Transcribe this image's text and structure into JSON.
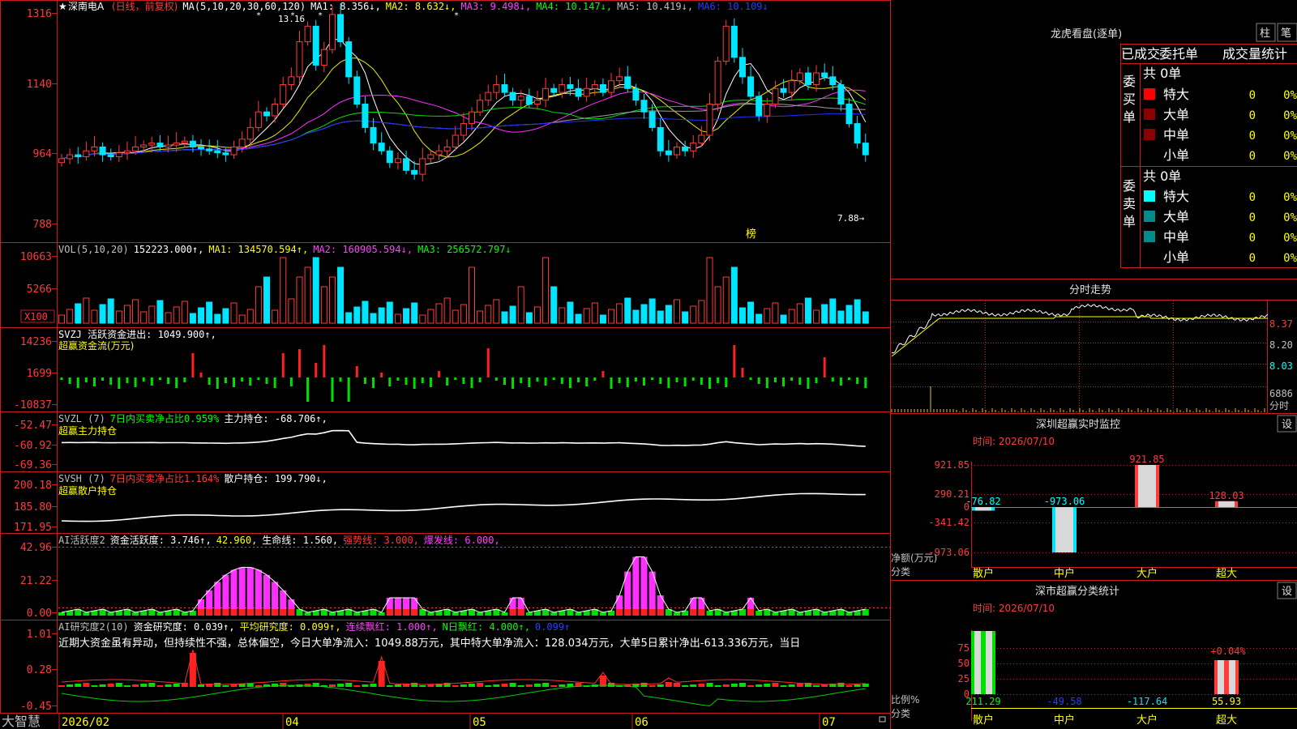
{
  "colors": {
    "up": "#ff3b3b",
    "down": "#00e5ff",
    "frame": "#c81e1e",
    "ma1": "#ffffff",
    "ma2": "#e8e800",
    "ma3": "#ff30ff",
    "ma4": "#00e000",
    "ma5": "#a0a0a0",
    "ma6": "#2030ff",
    "yellow": "#ffff00",
    "green": "#00ff00",
    "magenta": "#ff40ff",
    "cyan": "#00ffff"
  },
  "main": {
    "star": "★",
    "stock_name": "深南电A",
    "period": "(日线，前复权)",
    "ma_legend": [
      {
        "text": "MA(5,10,20,30,60,120)",
        "color": "#ffffff"
      },
      {
        "text": "MA1: 8.356↓,",
        "color": "#ffffff"
      },
      {
        "text": "MA2: 8.632↓,",
        "color": "#ffff00"
      },
      {
        "text": "MA3: 9.498↓,",
        "color": "#ff40ff"
      },
      {
        "text": "MA4: 10.147↓,",
        "color": "#00ff00"
      },
      {
        "text": "MA5: 10.419↓,",
        "color": "#c0c0c0"
      },
      {
        "text": "MA6: 10.109↓",
        "color": "#2040ff"
      }
    ],
    "y_labels": [
      "1316",
      "1140",
      "964",
      "788"
    ],
    "high_label": "13.16",
    "low_label": "7.88→",
    "bang": "榜"
  },
  "vol": {
    "legend": [
      {
        "text": "VOL(5,10,20)",
        "color": "#c0c0c0"
      },
      {
        "text": "152223.000↑,",
        "color": "#ffffff"
      },
      {
        "text": "MA1: 134570.594↑,",
        "color": "#ffff00"
      },
      {
        "text": "MA2: 160905.594↓,",
        "color": "#ff40ff"
      },
      {
        "text": "MA3: 256572.797↓",
        "color": "#00ff00"
      }
    ],
    "y_labels": [
      "10663",
      "5266"
    ],
    "unit": "X100"
  },
  "svzj": {
    "legend": [
      {
        "text": "SVZJ  活跃资金进出: 1049.900↑,",
        "color": "#ffffff"
      }
    ],
    "sub": "超赢资金流(万元)",
    "y_labels": [
      "14236",
      "1699",
      "-10837"
    ]
  },
  "svzl": {
    "legend": [
      {
        "text": "SVZL (7)",
        "color": "#c0c0c0"
      },
      {
        "text": "7日内买卖净占比0.959%",
        "color": "#00ff00"
      },
      {
        "text": "主力持仓: -68.706↑,",
        "color": "#ffffff"
      }
    ],
    "sub": "超赢主力持仓",
    "y_labels": [
      "-52.47",
      "-60.92",
      "-69.36"
    ]
  },
  "svsh": {
    "legend": [
      {
        "text": "SVSH (7)",
        "color": "#c0c0c0"
      },
      {
        "text": "7日内买卖净占比1.164%",
        "color": "#ff3b3b"
      },
      {
        "text": "散户持仓: 199.790↓,",
        "color": "#ffffff"
      }
    ],
    "sub": "超赢散户持仓",
    "y_labels": [
      "200.18",
      "185.80",
      "171.95"
    ]
  },
  "ai1": {
    "legend": [
      {
        "text": "AI活跃度2",
        "color": "#c0c0c0"
      },
      {
        "text": "资金活跃度: 3.746↑,",
        "color": "#ffffff"
      },
      {
        "text": "42.960,",
        "color": "#ffff00"
      },
      {
        "text": "生命线: 1.560,",
        "color": "#ffffff"
      },
      {
        "text": "强势线: 3.000,",
        "color": "#ff3b3b"
      },
      {
        "text": "爆发线: 6.000,",
        "color": "#ff40ff"
      }
    ],
    "y_labels": [
      "42.96",
      "21.22",
      "0.00"
    ]
  },
  "ai2": {
    "legend": [
      {
        "text": "AI研究度2(10)",
        "color": "#c0c0c0"
      },
      {
        "text": "资金研究度: 0.039↑,",
        "color": "#ffffff"
      },
      {
        "text": "平均研究度: 0.099↑,",
        "color": "#ffff00"
      },
      {
        "text": "连续飘红: 1.000↑,",
        "color": "#ff40ff"
      },
      {
        "text": "N日飘红: 4.000↑,",
        "color": "#00ff00"
      },
      {
        "text": "0.099↑",
        "color": "#2040ff"
      }
    ],
    "comment": "近期大资金虽有异动，但持续性不强，总体偏空，今日大单净流入：1049.88万元，其中特大单净流入：128.034万元，大单5日累计净出-613.336万元，当日",
    "y_labels": [
      "1.01",
      "0.28",
      "-0.45"
    ]
  },
  "xaxis": {
    "brand": "大智慧",
    "labels": [
      "2026/02",
      "04",
      "05",
      "06",
      "07"
    ]
  },
  "longhu": {
    "title": "龙虎看盘(逐单)",
    "btn_zhu": "柱",
    "btn_bi": "笔",
    "tabs": [
      "已成交",
      "委托单",
      "成交量统计"
    ],
    "buy_label": "委买单",
    "sell_label": "委卖单",
    "buy_total": "共 0单",
    "sell_total": "共 0单",
    "buy_rows": [
      {
        "name": "特大",
        "count": "0",
        "pct": "0%",
        "color": "#ff0000"
      },
      {
        "name": "大单",
        "count": "0",
        "pct": "0%",
        "color": "#8b0000"
      },
      {
        "name": "中单",
        "count": "0",
        "pct": "0%",
        "color": "#8b0000"
      },
      {
        "name": "小单",
        "count": "0",
        "pct": "0%",
        "color": ""
      }
    ],
    "sell_rows": [
      {
        "name": "特大",
        "count": "0",
        "pct": "0%",
        "color": "#00ffff"
      },
      {
        "name": "大单",
        "count": "0",
        "pct": "0%",
        "color": "#008b8b"
      },
      {
        "name": "中单",
        "count": "0",
        "pct": "0%",
        "color": "#008b8b"
      },
      {
        "name": "小单",
        "count": "0",
        "pct": "0%",
        "color": ""
      }
    ]
  },
  "intraday": {
    "title": "分时走势",
    "prices": [
      "8.37",
      "8.20",
      "8.03"
    ],
    "vol": "6886",
    "vol_unit": "分时"
  },
  "monitor": {
    "title": "深圳超赢实时监控",
    "settings": "设",
    "time": "时间: 2026/07/10",
    "y_labels": [
      "921.85",
      "290.21",
      "0",
      "-341.42",
      "-973.06"
    ],
    "ylabel": "净额(万元)",
    "xlabel": "分类",
    "categories": [
      "散户",
      "中户",
      "大户",
      "超大"
    ],
    "values": [
      -76.82,
      -973.06,
      921.85,
      128.03
    ],
    "value_labels": [
      "-76.82",
      "-973.06",
      "921.85",
      "128.03"
    ]
  },
  "classify": {
    "title": "深市超赢分类统计",
    "settings": "设",
    "time": "时间: 2026/07/10",
    "y_labels": [
      "75",
      "50",
      "25",
      "0"
    ],
    "ylabel": "比例%",
    "xlabel": "分类",
    "top_label": "+0.04%",
    "categories": [
      "散户",
      "中户",
      "大户",
      "超大"
    ],
    "values": [
      211.29,
      -49.58,
      -117.64,
      55.93
    ],
    "value_labels": [
      "211.29",
      "-49.58",
      "-117.64",
      "55.93"
    ]
  },
  "chart_data": [
    {
      "type": "bar",
      "title": "深圳超赢实时监控",
      "ylabel": "净额(万元)",
      "xlabel": "分类",
      "categories": [
        "散户",
        "中户",
        "大户",
        "超大"
      ],
      "values": [
        -76.82,
        -973.06,
        921.85,
        128.03
      ],
      "ylim": [
        -973.06,
        921.85
      ]
    },
    {
      "type": "bar",
      "title": "深市超赢分类统计",
      "ylabel": "比例%",
      "xlabel": "分类",
      "categories": [
        "散户",
        "中户",
        "大户",
        "超大"
      ],
      "values": [
        211.29,
        -49.58,
        -117.64,
        55.93
      ],
      "ylim": [
        0,
        75
      ]
    }
  ]
}
